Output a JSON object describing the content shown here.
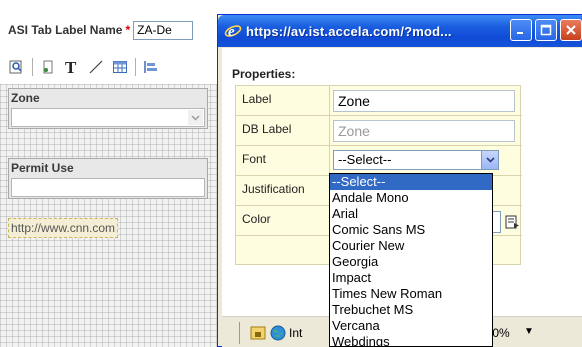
{
  "designer": {
    "asi_tab_label": "ASI Tab Label Name",
    "required_mark": "*",
    "asi_tab_value": "ZA-De",
    "widgets": [
      {
        "label": "Zone"
      },
      {
        "label": "Permit Use"
      }
    ],
    "link_text": "http://www.cnn.com",
    "toolbar_icons": [
      "search-icon",
      "page-icon",
      "text-tool-icon",
      "line-tool-icon",
      "table-icon",
      "align-icon"
    ]
  },
  "popup": {
    "title": "https://av.ist.accela.com/?mod...",
    "properties_heading": "Properties:",
    "rows": [
      {
        "label": "Label",
        "value": "Zone"
      },
      {
        "label": "DB Label",
        "placeholder": "Zone"
      },
      {
        "label": "Font",
        "selected": "--Select--"
      },
      {
        "label": "Justification"
      },
      {
        "label": "Color"
      }
    ],
    "font_options": [
      "--Select--",
      "Andale Mono",
      "Arial",
      "Comic Sans MS",
      "Courier New",
      "Georgia",
      "Impact",
      "Times New Roman",
      "Trebuchet MS",
      "Vercana",
      "Webdings"
    ],
    "highlighted_option_index": 0,
    "status": {
      "zone": "Int",
      "zoom": "100%"
    }
  },
  "colors": {
    "title_blue": "#1b5fe0",
    "selection_blue": "#316ac5",
    "props_background": "#fffde0",
    "required_red": "#d00000"
  }
}
